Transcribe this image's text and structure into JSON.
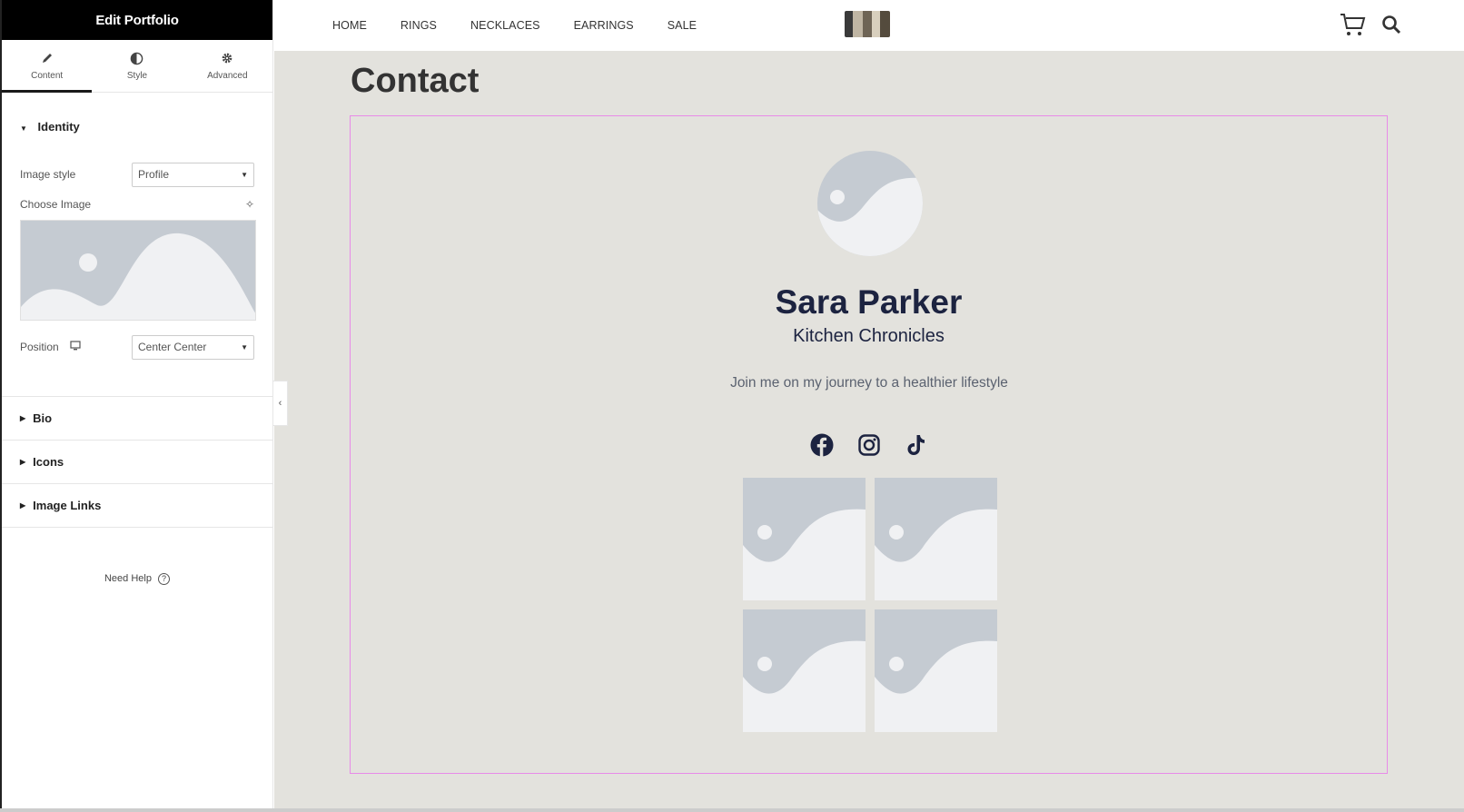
{
  "panel": {
    "title": "Edit Portfolio",
    "tabs": [
      {
        "label": "Content",
        "icon": "pencil-icon"
      },
      {
        "label": "Style",
        "icon": "contrast-icon"
      },
      {
        "label": "Advanced",
        "icon": "gear-icon"
      }
    ],
    "identity": {
      "title": "Identity",
      "image_style_label": "Image style",
      "image_style_value": "Profile",
      "choose_image_label": "Choose Image",
      "position_label": "Position",
      "position_value": "Center Center"
    },
    "sections": [
      "Bio",
      "Icons",
      "Image Links"
    ],
    "help_label": "Need Help"
  },
  "site": {
    "nav": [
      "HOME",
      "RINGS",
      "NECKLACES",
      "EARRINGS",
      "SALE"
    ],
    "page_title": "Contact"
  },
  "profile": {
    "name": "Sara Parker",
    "subtitle": "Kitchen Chronicles",
    "bio": "Join me on my journey to a healthier lifestyle",
    "socials": [
      "facebook-icon",
      "instagram-icon",
      "tiktok-icon"
    ]
  },
  "colors": {
    "panel_header": "#000000",
    "preview_bg": "#e3e2dd",
    "heading": "#1c2340",
    "widget_outline": "#e88be8",
    "placeholder": "#c5cbd2"
  }
}
